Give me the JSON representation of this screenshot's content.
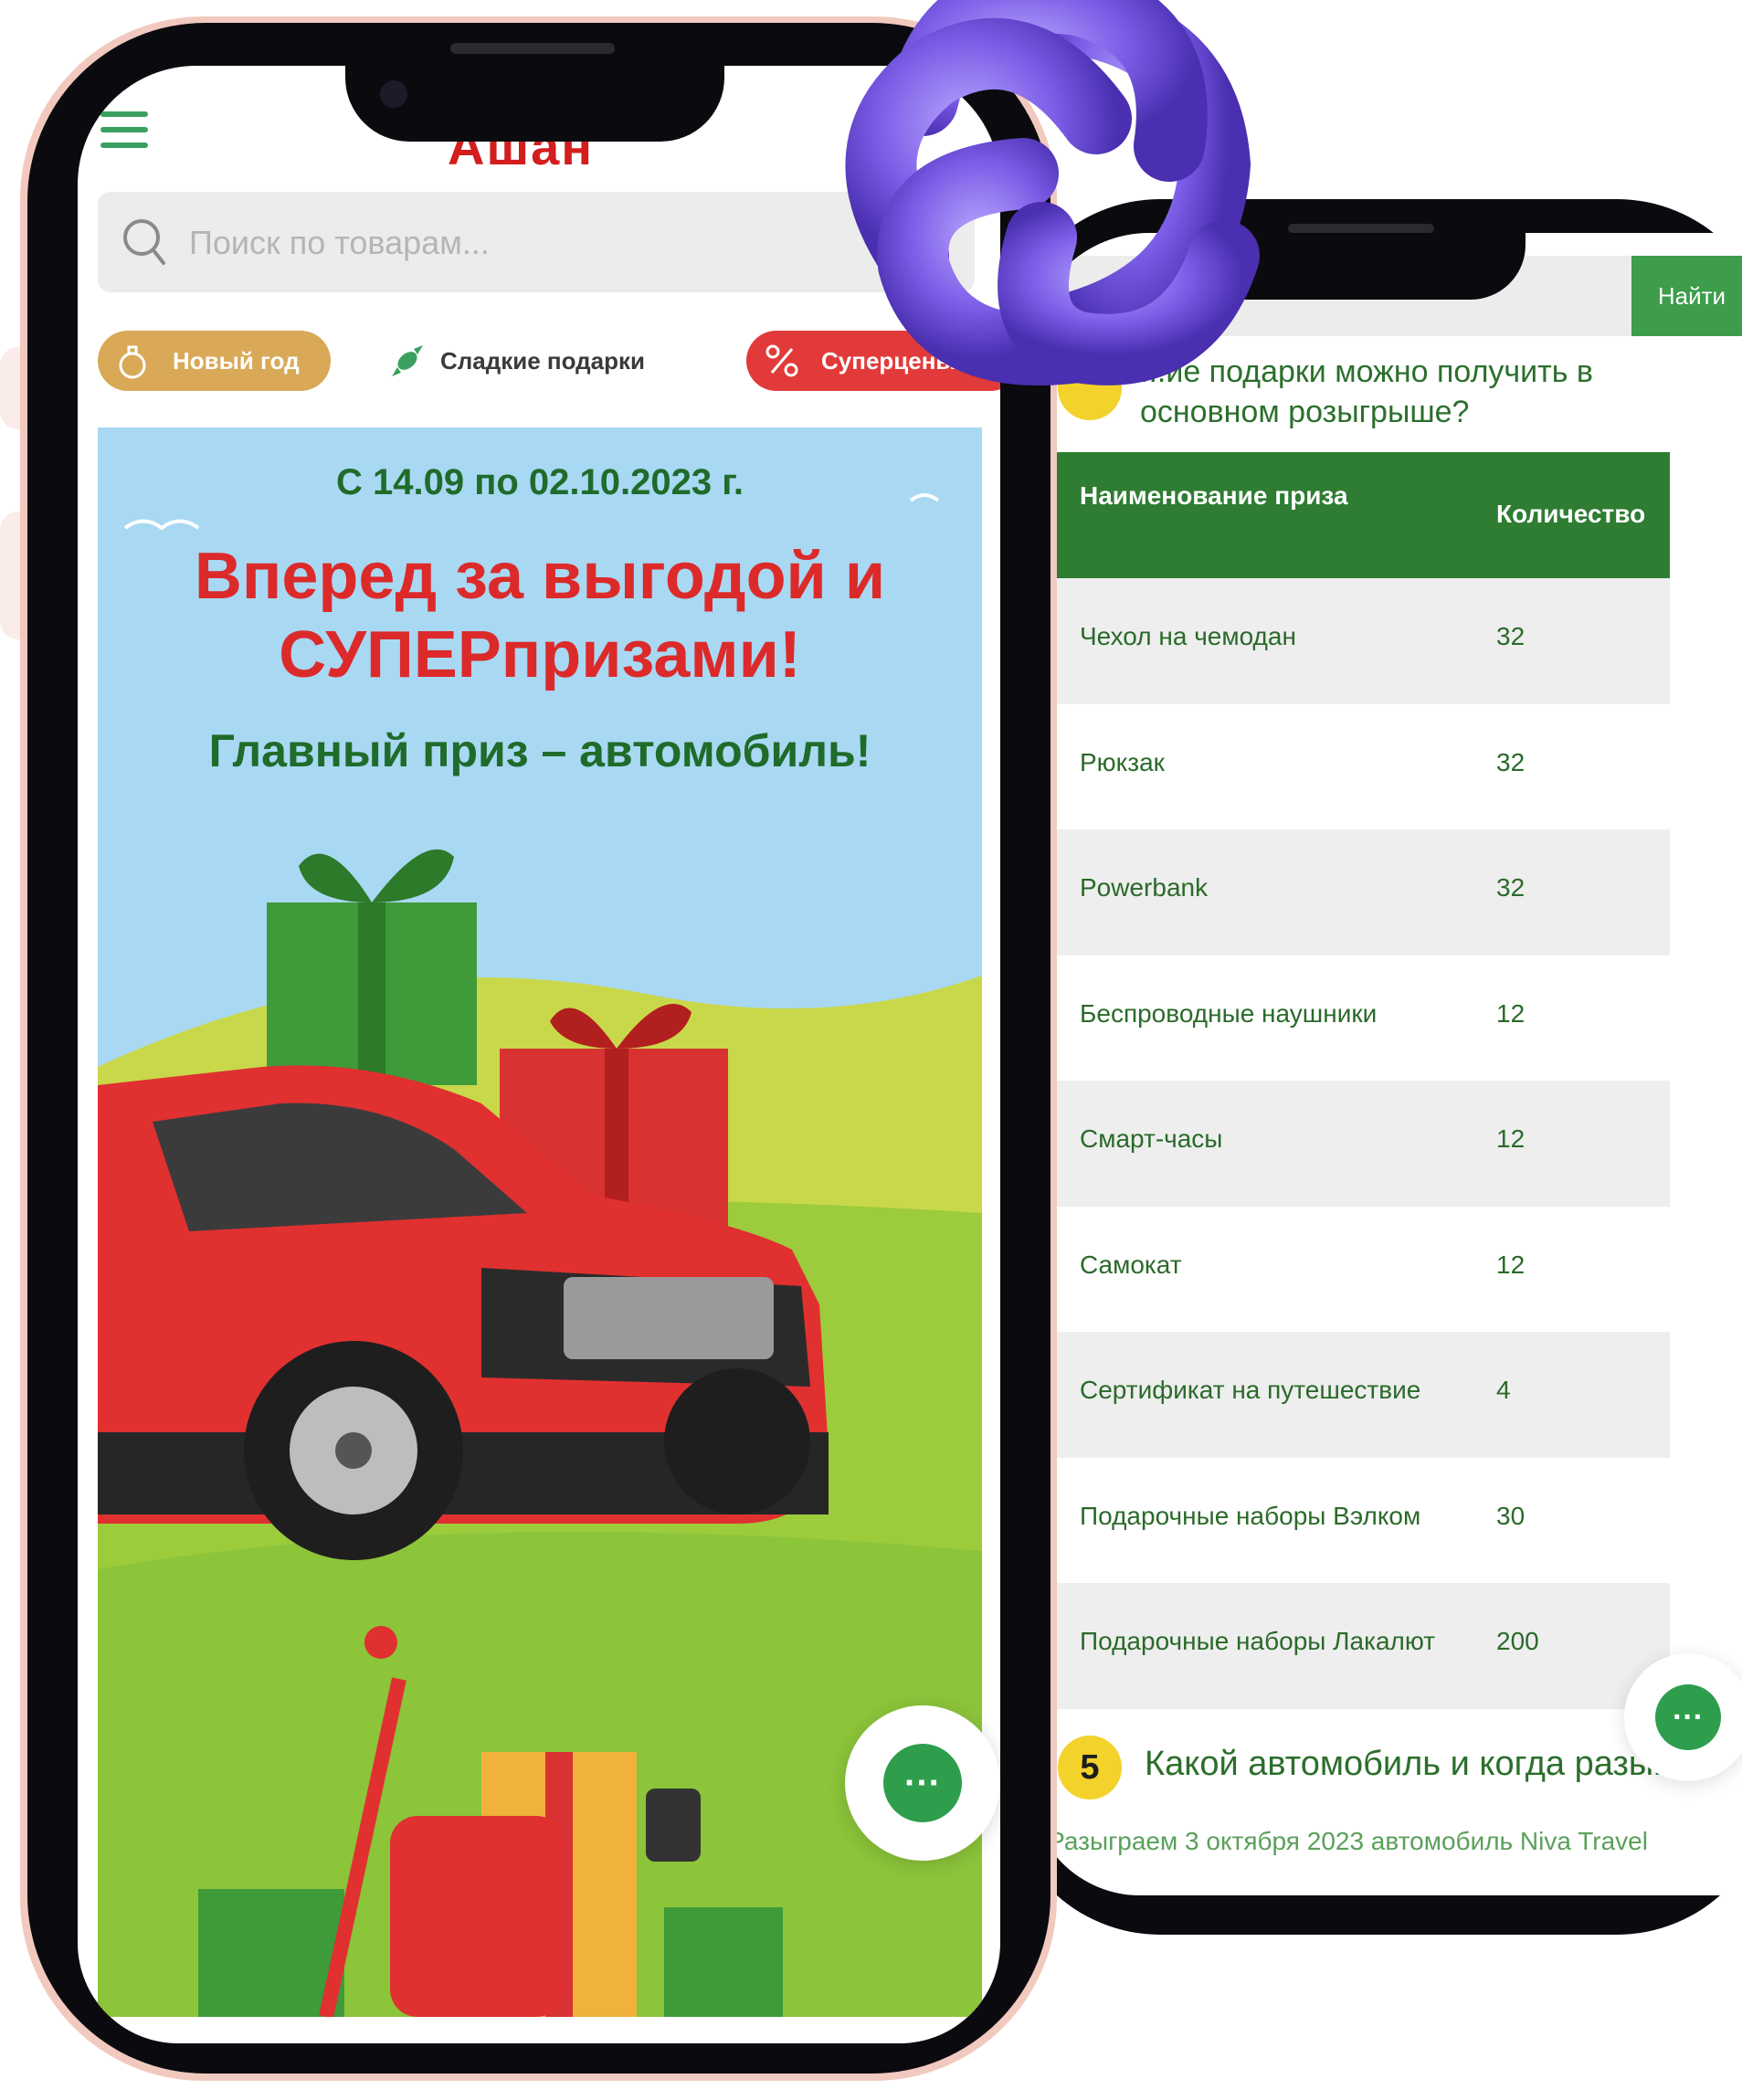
{
  "phone_left": {
    "logo": "Ашан",
    "search_placeholder": "Поиск по товарам...",
    "chips": {
      "new_year": "Новый год",
      "sweet_gifts": "Сладкие подарки",
      "super_prices": "Суперцены"
    },
    "banner": {
      "dates": "С 14.09 по 02.10.2023 г.",
      "title_line1": "Вперед за выгодой и",
      "title_line2": "СУПЕРпризами!",
      "subtitle": "Главный приз – автомобиль!"
    },
    "chat_icon": "chat-bubble-icon"
  },
  "phone_right": {
    "find_button": "Найти",
    "question4": "...ие подарки можно получить в основном розыгрыше?",
    "table": {
      "headers": [
        "Наименование приза",
        "Количество"
      ],
      "rows": [
        [
          "Чехол на чемодан",
          "32"
        ],
        [
          "Рюкзак",
          "32"
        ],
        [
          "Powerbank",
          "32"
        ],
        [
          "Беспроводные наушники",
          "12"
        ],
        [
          "Смарт-часы",
          "12"
        ],
        [
          "Самокат",
          "12"
        ],
        [
          "Сертификат на путешествие",
          "4"
        ],
        [
          "Подарочные наборы Вэлком",
          "30"
        ],
        [
          "Подарочные наборы Лакалют",
          "200"
        ]
      ]
    },
    "question5_number": "5",
    "question5": "Какой автомобиль и когда разыг...",
    "answer5": "- Разыграем 3 октября 2023 автомобиль Niva Travel"
  },
  "colors": {
    "green": "#2e7d32",
    "red": "#dc2a2a",
    "gold": "#d9a957",
    "yellow_badge": "#f3d22b",
    "sky": "#a9d8f3",
    "knot_purple": "#7b5ce6"
  }
}
